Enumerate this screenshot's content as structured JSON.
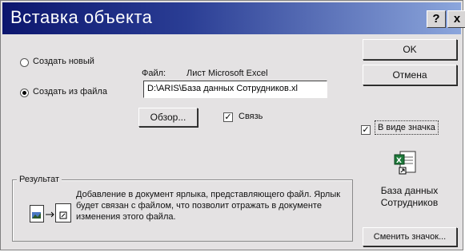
{
  "window": {
    "title": "Вставка объекта",
    "help_button": "?",
    "close_button": "x"
  },
  "options": {
    "create_new": "Создать новый",
    "create_from_file": "Создать из файла",
    "selected": "create_from_file"
  },
  "file": {
    "label": "Файл:",
    "type_text": "Лист Microsoft Excel",
    "path": "D:\\ARIS\\База данных Сотрудников.xl",
    "browse_button": "Обзор...",
    "link_label": "Связь",
    "link_checked": true
  },
  "buttons": {
    "ok": "OK",
    "cancel": "Отмена",
    "change_icon": "Сменить значок..."
  },
  "as_icon": {
    "label": "В виде значка",
    "checked": true,
    "caption_line1": "База данных",
    "caption_line2": "Сотрудников"
  },
  "result": {
    "legend": "Результат",
    "text": "Добавление в документ ярлыка, представляющего файл. Ярлык будет связан с файлом, что позволит отражать в документе изменения этого файла."
  },
  "colors": {
    "title_start": "#0c166e",
    "title_end": "#8ca6dc",
    "dialog_bg": "#e4e2e3",
    "excel_green": "#1d7a3a"
  }
}
